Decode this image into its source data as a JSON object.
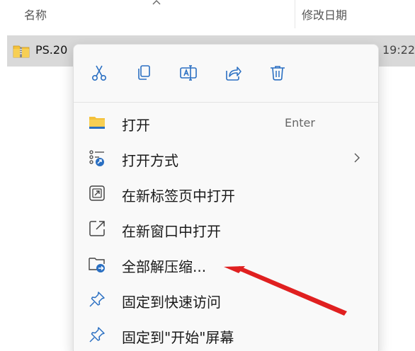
{
  "explorer": {
    "column_name_header": "名称",
    "column_date_header": "修改日期",
    "file": {
      "name": "PS.20",
      "time_partial": "19:22",
      "icon": "zip-folder-icon"
    }
  },
  "context_menu": {
    "quick_actions": [
      {
        "name": "cut",
        "icon": "scissors-icon"
      },
      {
        "name": "copy",
        "icon": "copy-icon"
      },
      {
        "name": "rename",
        "icon": "rename-icon"
      },
      {
        "name": "share",
        "icon": "share-icon"
      },
      {
        "name": "delete",
        "icon": "trash-icon"
      }
    ],
    "items": [
      {
        "label": "打开",
        "shortcut": "Enter",
        "icon": "folder-icon"
      },
      {
        "label": "打开方式",
        "icon": "open-with-icon",
        "submenu": true
      },
      {
        "label": "在新标签页中打开",
        "icon": "open-new-tab-icon"
      },
      {
        "label": "在新窗口中打开",
        "icon": "open-new-window-icon"
      },
      {
        "label": "全部解压缩...",
        "icon": "extract-all-icon"
      },
      {
        "label": "固定到快速访问",
        "icon": "pin-icon"
      },
      {
        "label": "固定到\"开始\"屏幕",
        "icon": "pin-icon"
      }
    ]
  },
  "colors": {
    "accent_blue": "#2a6fc2",
    "selection_gray": "#d9d9d9",
    "annotation_red": "#e02020",
    "folder_yellow": "#f4c13a"
  }
}
